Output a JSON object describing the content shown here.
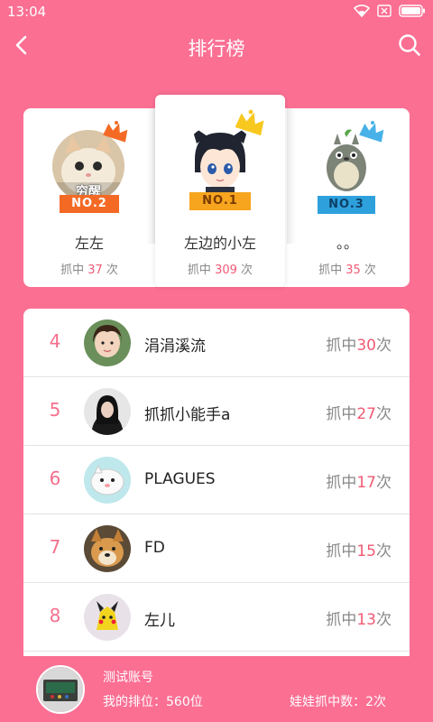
{
  "status_bar": {
    "time": "13:04",
    "icons": [
      "wifi-icon",
      "sim-off-icon",
      "battery-icon"
    ]
  },
  "header": {
    "title": "排行榜",
    "back_icon": "chevron-left-icon",
    "search_icon": "search-icon"
  },
  "podium": [
    {
      "rank_label": "NO.2",
      "name": "左左",
      "count_prefix": "抓中",
      "count": "37",
      "count_suffix": "次",
      "avatar_caption": "穷醒",
      "ribbon_color": "#f46a25",
      "crown_color": "#f46a25"
    },
    {
      "rank_label": "NO.1",
      "name": "左边的小左",
      "count_prefix": "抓中",
      "count": "309",
      "count_suffix": "次",
      "ribbon_color": "#f7a51e",
      "crown_color": "#f8c81f"
    },
    {
      "rank_label": "NO.3",
      "name": "。。",
      "count_prefix": "抓中",
      "count": "35",
      "count_suffix": "次",
      "ribbon_color": "#2ea1dd",
      "crown_color": "#48b2e8"
    }
  ],
  "list": [
    {
      "rank": "4",
      "name": "涓涓溪流",
      "count_prefix": "抓中",
      "count": "30",
      "count_suffix": "次"
    },
    {
      "rank": "5",
      "name": "抓抓小能手a",
      "count_prefix": "抓中",
      "count": "27",
      "count_suffix": "次"
    },
    {
      "rank": "6",
      "name": "PLAGUES",
      "count_prefix": "抓中",
      "count": "17",
      "count_suffix": "次"
    },
    {
      "rank": "7",
      "name": "FD",
      "count_prefix": "抓中",
      "count": "15",
      "count_suffix": "次"
    },
    {
      "rank": "8",
      "name": "左儿",
      "count_prefix": "抓中",
      "count": "13",
      "count_suffix": "次"
    }
  ],
  "my_info": {
    "name": "测试账号",
    "rank_text": "我的排位：560位",
    "catch_text": "娃娃抓中数：2次"
  },
  "colors": {
    "background": "#fb6f93",
    "accent_number": "#f05a74",
    "rank_number": "#f66f8c"
  }
}
